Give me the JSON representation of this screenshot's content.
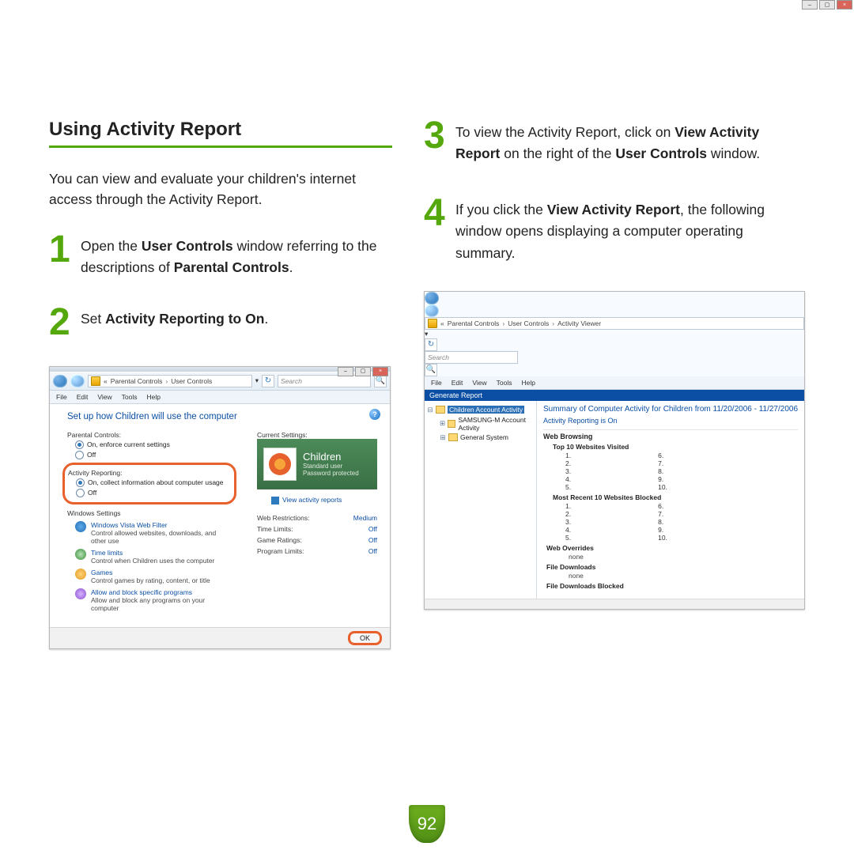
{
  "section_title": "Using Activity Report",
  "intro": "You can view and evaluate your children's internet access through the Activity Report.",
  "steps": {
    "s1": {
      "num": "1",
      "pre": "Open the ",
      "b1": "User Controls",
      "mid": " window referring to the descriptions of ",
      "b2": "Parental Controls",
      "post": "."
    },
    "s2": {
      "num": "2",
      "pre": "Set ",
      "b1": "Activity Reporting to On",
      "post": "."
    },
    "s3": {
      "num": "3",
      "pre": "To view the Activity Report, click on ",
      "b1": "View Activity Report",
      "mid": " on the right of the ",
      "b2": "User Controls",
      "post": " window."
    },
    "s4": {
      "num": "4",
      "pre": "If you click the ",
      "b1": "View Activity Report",
      "post": ", the following window opens displaying a computer operating summary."
    }
  },
  "shot1": {
    "breadcrumb": {
      "chev": "«",
      "a": "Parental Controls",
      "sep": "›",
      "b": "User Controls"
    },
    "search_placeholder": "Search",
    "menus": {
      "file": "File",
      "edit": "Edit",
      "view": "View",
      "tools": "Tools",
      "help": "Help"
    },
    "heading": "Set up how Children will use the computer",
    "pc_label": "Parental Controls:",
    "pc_on": "On, enforce current settings",
    "pc_off": "Off",
    "ar_label": "Activity Reporting:",
    "ar_on": "On, collect information about computer usage",
    "ar_off": "Off",
    "ws_label": "Windows Settings",
    "ws": [
      {
        "link": "Windows Vista Web Filter",
        "desc": "Control allowed websites, downloads, and other use"
      },
      {
        "link": "Time limits",
        "desc": "Control when Children uses the computer"
      },
      {
        "link": "Games",
        "desc": "Control games by rating, content, or title"
      },
      {
        "link": "Allow and block specific programs",
        "desc": "Allow and block any programs on your computer"
      }
    ],
    "cs_label": "Current Settings:",
    "card": {
      "name": "Children",
      "l1": "Standard user",
      "l2": "Password protected"
    },
    "view_link": "View activity reports",
    "settings": [
      {
        "k": "Web Restrictions:",
        "v": "Medium"
      },
      {
        "k": "Time Limits:",
        "v": "Off"
      },
      {
        "k": "Game Ratings:",
        "v": "Off"
      },
      {
        "k": "Program Limits:",
        "v": "Off"
      }
    ],
    "ok": "OK"
  },
  "shot2": {
    "breadcrumb": {
      "chev": "«",
      "a": "Parental Controls",
      "s": "›",
      "b": "User Controls",
      "c": "Activity Viewer"
    },
    "search_placeholder": "Search",
    "menus": {
      "file": "File",
      "edit": "Edit",
      "view": "View",
      "tools": "Tools",
      "help": "Help"
    },
    "gen": "Generate Report",
    "tree": {
      "sel": "Children Account Activity",
      "n2": "SAMSUNG-M Account Activity",
      "n3": "General System"
    },
    "summary": "Summary of Computer Activity for Children from 11/20/2006 - 11/27/2006",
    "actline": "Activity Reporting is On",
    "wb": "Web Browsing",
    "top10": "Top 10 Websites Visited",
    "list_a": [
      "1.",
      "2.",
      "3.",
      "4.",
      "5."
    ],
    "list_b": [
      "6.",
      "7.",
      "8.",
      "9.",
      "10."
    ],
    "blocked": "Most Recent 10 Websites Blocked",
    "overrides": "Web Overrides",
    "none": "none",
    "fdl": "File Downloads",
    "fdlb": "File Downloads Blocked"
  },
  "page_number": "92"
}
